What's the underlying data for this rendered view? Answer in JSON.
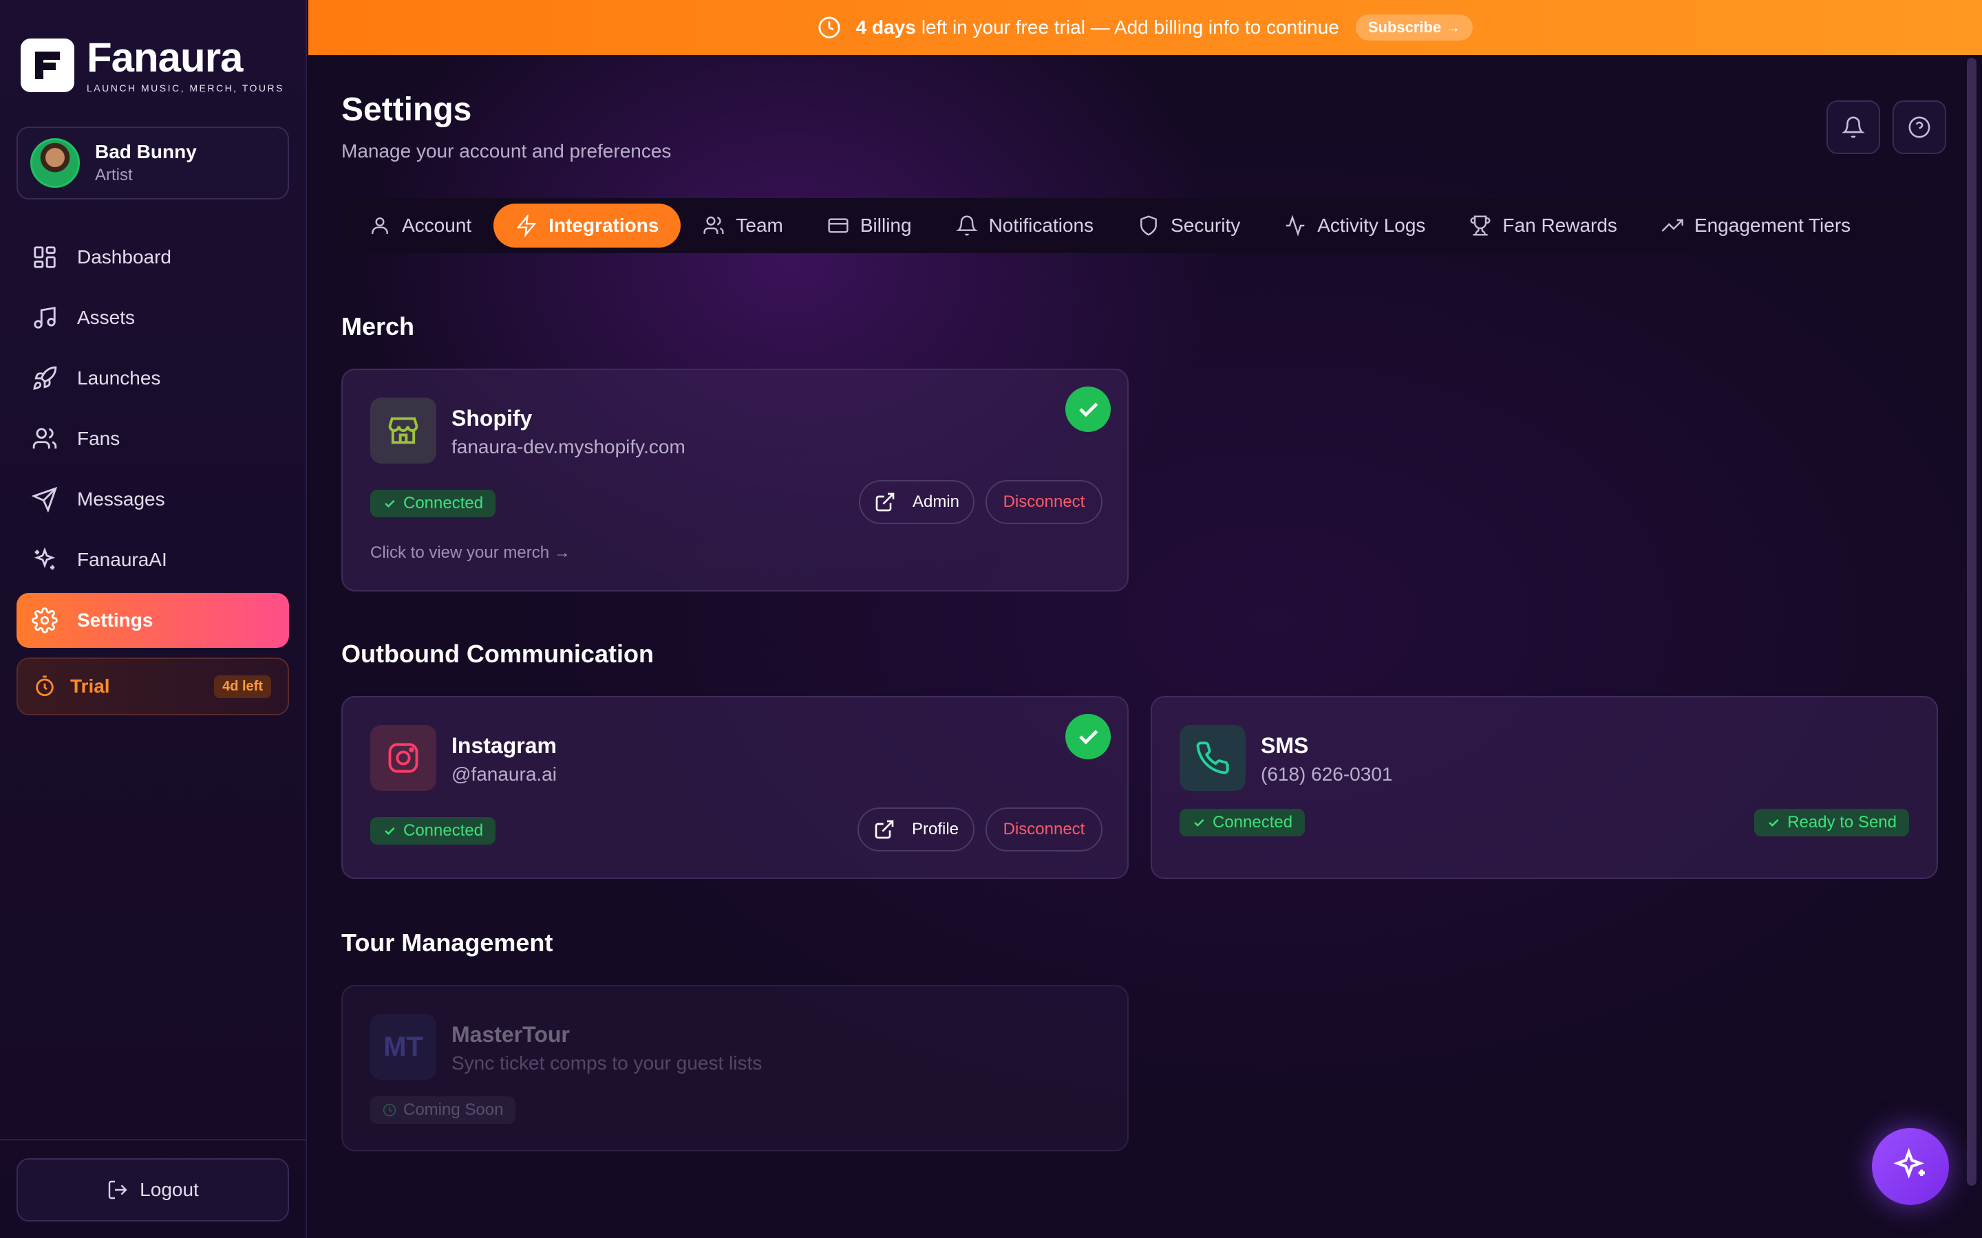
{
  "brand": {
    "name": "Fanaura",
    "tagline": "LAUNCH MUSIC, MERCH, TOURS"
  },
  "user": {
    "name": "Bad Bunny",
    "role": "Artist"
  },
  "sidebar": {
    "items": [
      {
        "label": "Dashboard",
        "icon": "dashboard-icon"
      },
      {
        "label": "Assets",
        "icon": "music-note-icon"
      },
      {
        "label": "Launches",
        "icon": "rocket-icon"
      },
      {
        "label": "Fans",
        "icon": "users-icon"
      },
      {
        "label": "Messages",
        "icon": "send-icon"
      },
      {
        "label": "FanauraAI",
        "icon": "sparkles-icon"
      },
      {
        "label": "Settings",
        "icon": "gear-icon",
        "active": true
      }
    ],
    "trial": {
      "label": "Trial",
      "badge": "4d left"
    },
    "logout": "Logout"
  },
  "banner": {
    "bold": "4 days",
    "text": "left in your free trial — Add billing info to continue",
    "button": "Subscribe →"
  },
  "page": {
    "title": "Settings",
    "subtitle": "Manage your account and preferences"
  },
  "tabs": [
    {
      "label": "Account",
      "icon": "user-icon"
    },
    {
      "label": "Integrations",
      "icon": "lightning-icon",
      "active": true
    },
    {
      "label": "Team",
      "icon": "team-icon"
    },
    {
      "label": "Billing",
      "icon": "credit-card-icon"
    },
    {
      "label": "Notifications",
      "icon": "bell-icon"
    },
    {
      "label": "Security",
      "icon": "shield-icon"
    },
    {
      "label": "Activity Logs",
      "icon": "activity-icon"
    },
    {
      "label": "Fan Rewards",
      "icon": "trophy-icon"
    },
    {
      "label": "Engagement Tiers",
      "icon": "trending-up-icon"
    }
  ],
  "sections": {
    "merch": {
      "title": "Merch",
      "shopify": {
        "name": "Shopify",
        "detail": "fanaura-dev.myshopify.com",
        "status": "Connected",
        "admin_label": "Admin",
        "disconnect_label": "Disconnect",
        "link": "Click to view your merch →"
      }
    },
    "outbound": {
      "title": "Outbound Communication",
      "instagram": {
        "name": "Instagram",
        "detail": "@fanaura.ai",
        "status": "Connected",
        "profile_label": "Profile",
        "disconnect_label": "Disconnect"
      },
      "sms": {
        "name": "SMS",
        "detail": "(618) 626-0301",
        "status": "Connected",
        "ready": "Ready to Send"
      }
    },
    "tour": {
      "title": "Tour Management",
      "mastertour": {
        "name": "MasterTour",
        "detail": "Sync ticket comps to your guest lists",
        "status": "Coming Soon",
        "logo_text": "MT"
      }
    }
  },
  "colors": {
    "accent": "#ff7a1a",
    "success": "#1fbf55",
    "danger": "#ff5a68",
    "banner": "#ff8a1a"
  }
}
